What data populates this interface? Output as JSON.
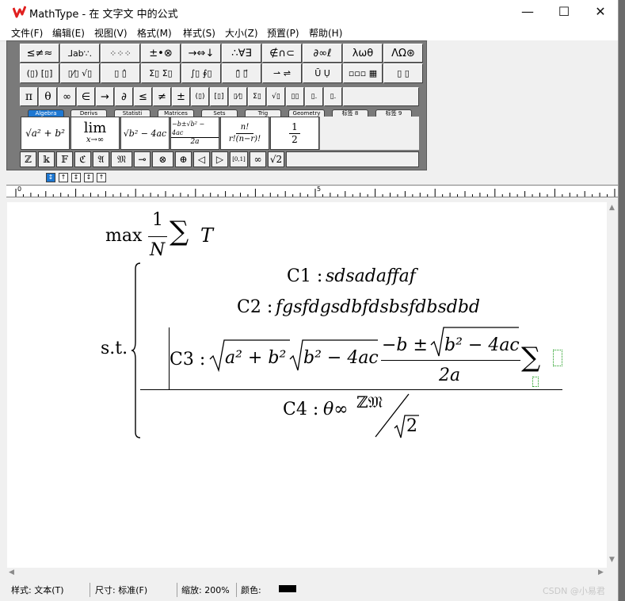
{
  "window": {
    "title": "MathType - 在 文字文 中的公式",
    "minimize": "—",
    "maximize": "☐",
    "close": "✕"
  },
  "menu": [
    "文件(F)",
    "编辑(E)",
    "视图(V)",
    "格式(M)",
    "样式(S)",
    "大小(Z)",
    "预置(P)",
    "帮助(H)"
  ],
  "palette_row1": [
    "≤≠≈",
    "⅃ab∵.",
    "⁘⁘⁘",
    "±•⊗",
    "→⇔↓",
    "∴∀∃",
    "∉∩⊂",
    "∂∞ℓ",
    "λωθ",
    "ΛΩ⊛"
  ],
  "palette_row2": [
    "(▯) [▯]",
    "▯⁄▯ √▯",
    "▯ ▯̂",
    "Σ▯ Σ▯",
    "∫▯ ∮▯",
    "▯̄ ▯⃗",
    "⇀ ⇌",
    "Ū Ụ",
    "▫▫▫ ▦",
    "▯ ▯"
  ],
  "symbol_bar": [
    "π",
    "θ",
    "∞",
    "∈",
    "→",
    "∂",
    "≤",
    "≠",
    "±",
    "(▯)",
    "[▯]",
    "▯⁄▯",
    "Σ▯",
    "√▯",
    "▯▯",
    "▯.",
    "▯."
  ],
  "tabs": [
    "Algebra",
    "Derivs",
    "Statisti",
    "Matrices",
    "Sets",
    "Trig",
    "Geometry",
    "标签 8",
    "标签 9"
  ],
  "templates": {
    "t1": "√a² + b²",
    "t2_lim": "lim",
    "t2_sub": "x→∞",
    "t3": "√b² − 4ac",
    "t4_num": "−b±√b² − 4ac",
    "t4_den": "2a",
    "t5_num": "n!",
    "t5_den": "r!(n−r)!",
    "t6_num": "1",
    "t6_den": "2"
  },
  "small_bar": [
    "ℤ",
    "𝕜",
    "𝔽",
    "ℭ",
    "𝔄",
    "𝔐",
    "⊸",
    "⊗",
    "⊕",
    "◁",
    "▷",
    "[0,1]",
    "∞",
    "√2"
  ],
  "nudge": [
    "↕",
    "↑",
    "↕",
    "↕",
    "↑"
  ],
  "ruler": {
    "label0": "0",
    "label5": "5"
  },
  "equation": {
    "max": "max",
    "frac_num": "1",
    "frac_den": "N",
    "sum": "∑",
    "T": "T",
    "st": "s.t.",
    "c1_label": "C1 : ",
    "c1_text": "sdsadaffaf",
    "c2_label": "C2 : ",
    "c2_text": "fgsfdgsdbfdsbsfdbsdbd",
    "c3_label": "C3 : ",
    "c3_rad1": "a² + b²",
    "c3_rad2": "b² − 4ac",
    "c3_num_pre": "−b ± ",
    "c3_num_rad": "b² − 4ac",
    "c3_den": "2a",
    "c3_sum": "∑",
    "c4_label": "C4 : ",
    "c4_theta": "θ∞",
    "c4_num": "ℤ𝔐",
    "c4_den": "2"
  },
  "status": {
    "style": "样式: 文本(T)",
    "size": "尺寸: 标准(F)",
    "zoom": "缩放: 200%",
    "color": "颜色:"
  },
  "watermark": "CSDN @小易君",
  "colors": {
    "tab_active": "#1e78d2",
    "placeholder": "#1a9a1a",
    "logo": "#e0201f"
  }
}
